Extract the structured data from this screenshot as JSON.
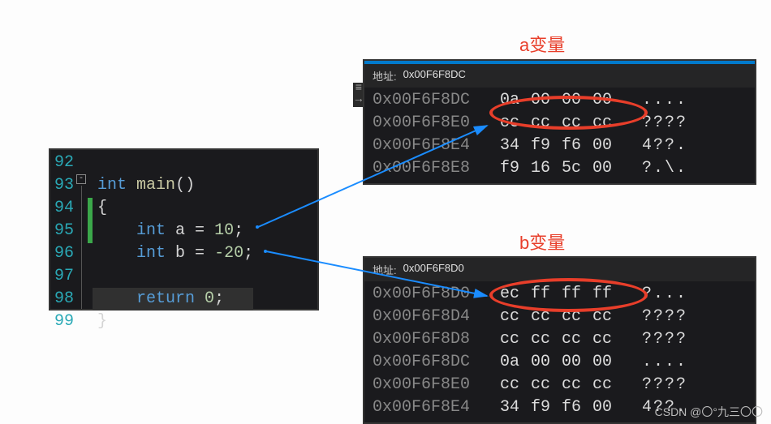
{
  "labels": {
    "a": "a变量",
    "b": "b变量"
  },
  "code": {
    "lines": [
      "92",
      "93",
      "94",
      "95",
      "96",
      "97",
      "98",
      "99"
    ],
    "tokens": {
      "int": "int",
      "main": "main",
      "parens": "()",
      "lbrace": "{",
      "decl_a_pre": "int",
      "decl_a_var": " a = ",
      "decl_a_val": "10",
      "decl_b_pre": "int",
      "decl_b_var": " b = ",
      "decl_b_val": "-20",
      "semi": ";",
      "ret": "return",
      "zero": " 0",
      "rbrace": "}"
    }
  },
  "mem_a": {
    "addr_label": "地址:",
    "addr_value": "0x00F6F8DC",
    "rows": [
      {
        "addr": "0x00F6F8DC",
        "bytes": [
          "0a",
          "00",
          "00",
          "00"
        ],
        "asc": "...."
      },
      {
        "addr": "0x00F6F8E0",
        "bytes": [
          "cc",
          "cc",
          "cc",
          "cc"
        ],
        "asc": "????"
      },
      {
        "addr": "0x00F6F8E4",
        "bytes": [
          "34",
          "f9",
          "f6",
          "00"
        ],
        "asc": "4??."
      },
      {
        "addr": "0x00F6F8E8",
        "bytes": [
          "f9",
          "16",
          "5c",
          "00"
        ],
        "asc": "?.\\."
      }
    ]
  },
  "mem_b": {
    "addr_label": "地址:",
    "addr_value": "0x00F6F8D0",
    "rows": [
      {
        "addr": "0x00F6F8D0",
        "bytes": [
          "ec",
          "ff",
          "ff",
          "ff"
        ],
        "asc": "?..."
      },
      {
        "addr": "0x00F6F8D4",
        "bytes": [
          "cc",
          "cc",
          "cc",
          "cc"
        ],
        "asc": "????"
      },
      {
        "addr": "0x00F6F8D8",
        "bytes": [
          "cc",
          "cc",
          "cc",
          "cc"
        ],
        "asc": "????"
      },
      {
        "addr": "0x00F6F8DC",
        "bytes": [
          "0a",
          "00",
          "00",
          "00"
        ],
        "asc": "...."
      },
      {
        "addr": "0x00F6F8E0",
        "bytes": [
          "cc",
          "cc",
          "cc",
          "cc"
        ],
        "asc": "????"
      },
      {
        "addr": "0x00F6F8E4",
        "bytes": [
          "34",
          "f9",
          "f6",
          "00"
        ],
        "asc": "4??."
      }
    ]
  },
  "watermark": "CSDN @〇°九三〇〇"
}
